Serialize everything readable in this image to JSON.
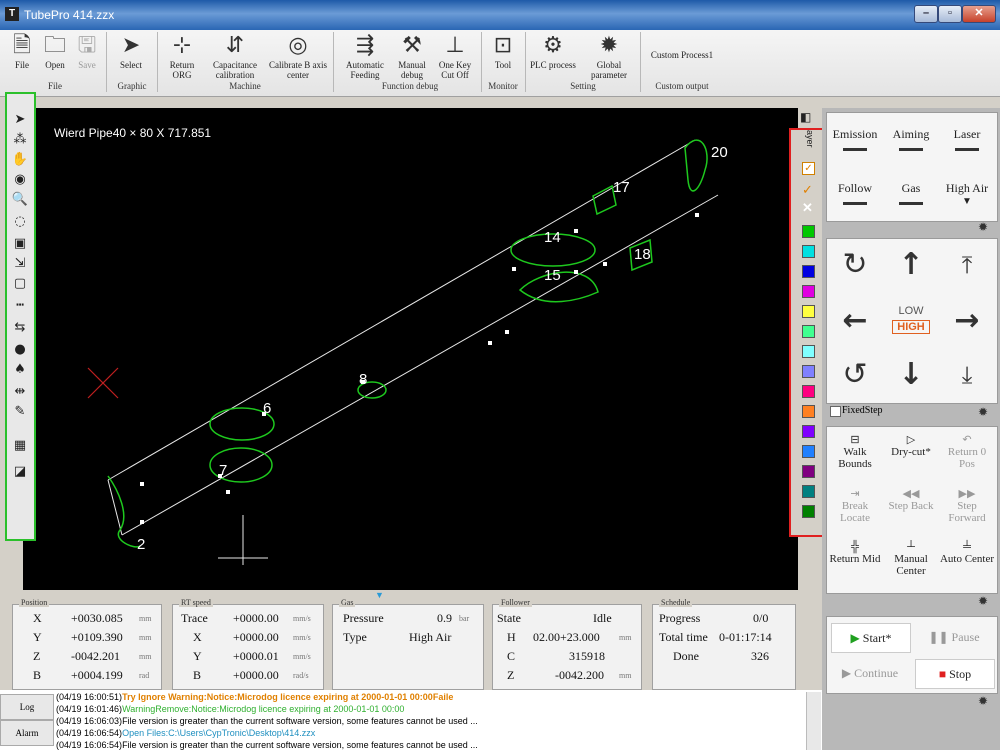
{
  "window": {
    "title": "TubePro 414.zzx",
    "logo": "T"
  },
  "ribbon": {
    "buttons": [
      {
        "label": "File",
        "icon": "file-icon"
      },
      {
        "label": "Open",
        "icon": "folder-icon"
      },
      {
        "label": "Save",
        "icon": "save-icon"
      },
      {
        "label": "Select",
        "icon": "cursor-icon"
      },
      {
        "label": "Return ORG",
        "icon": "axes-icon"
      },
      {
        "label": "Capacitance calibration",
        "icon": "calibrate-icon"
      },
      {
        "label": "Calibrate B axis center",
        "icon": "target-icon"
      },
      {
        "label": "Automatic Feeding",
        "icon": "feed-icon"
      },
      {
        "label": "Manual debug",
        "icon": "wrench-icon"
      },
      {
        "label": "One Key Cut Off",
        "icon": "cutoff-icon"
      },
      {
        "label": "Tool",
        "icon": "monitor-icon"
      },
      {
        "label": "PLC process",
        "icon": "plc-icon"
      },
      {
        "label": "Global parameter",
        "icon": "gear-icon"
      },
      {
        "label": "Custom Process1",
        "icon": ""
      }
    ],
    "groups": [
      "File",
      "Graphic",
      "Machine",
      "Function debug",
      "Monitor",
      "Setting",
      "Custom output"
    ]
  },
  "canvas": {
    "info": "Wierd Pipe40 × 80 X 717.851",
    "labels": [
      "20",
      "17",
      "14",
      "15",
      "18",
      "8",
      "6",
      "7",
      "2"
    ]
  },
  "layers": {
    "label": "ayer",
    "colors": [
      "#00c800",
      "#00e0e0",
      "#0000e0",
      "#e000e0",
      "#ffff40",
      "#40ff90",
      "#80ffff",
      "#8080ff",
      "#ff0080",
      "#ff8020",
      "#8000ff",
      "#2080ff",
      "#800080",
      "#008080",
      "#008000"
    ]
  },
  "laser_panel": {
    "items": [
      "Emission",
      "Aiming",
      "Laser",
      "Follow",
      "Gas",
      "High Air"
    ]
  },
  "jog": {
    "speed_low": "LOW",
    "speed_high": "HIGH",
    "fixed_step": "FixedStep"
  },
  "motion_panel": {
    "items": [
      "Walk Bounds",
      "Dry-cut*",
      "Return 0 Pos",
      "Break Locate",
      "Step Back",
      "Step Forward",
      "Return Mid",
      "Manual Center",
      "Auto Center"
    ]
  },
  "run_panel": {
    "start": "Start*",
    "pause": "Pause",
    "continue": "Continue",
    "stop": "Stop"
  },
  "status": {
    "position": {
      "title": "Position",
      "rows": [
        {
          "axis": "X",
          "value": "+0030.085",
          "unit": "mm"
        },
        {
          "axis": "Y",
          "value": "+0109.390",
          "unit": "mm"
        },
        {
          "axis": "Z",
          "value": "-0042.201",
          "unit": "mm"
        },
        {
          "axis": "B",
          "value": "+0004.199",
          "unit": "rad"
        }
      ]
    },
    "rt_speed": {
      "title": "RT speed",
      "rows": [
        {
          "axis": "Trace",
          "value": "+0000.00",
          "unit": "mm/s"
        },
        {
          "axis": "X",
          "value": "+0000.00",
          "unit": "mm/s"
        },
        {
          "axis": "Y",
          "value": "+0000.01",
          "unit": "mm/s"
        },
        {
          "axis": "B",
          "value": "+0000.00",
          "unit": "rad/s"
        }
      ]
    },
    "gas": {
      "title": "Gas",
      "pressure_label": "Pressure",
      "pressure_value": "0.9",
      "pressure_unit": "bar",
      "type_label": "Type",
      "type_value": "High Air"
    },
    "follower": {
      "title": "Follower",
      "rows": [
        {
          "label": "State",
          "value": "Idle",
          "unit": ""
        },
        {
          "label": "H",
          "value": "02.00+23.000",
          "unit": "mm"
        },
        {
          "label": "C",
          "value": "315918",
          "unit": ""
        },
        {
          "label": "Z",
          "value": "-0042.200",
          "unit": "mm"
        }
      ]
    },
    "schedule": {
      "title": "Schedule",
      "rows": [
        {
          "label": "Progress",
          "value": "0/0"
        },
        {
          "label": "Total time",
          "value": "0-01:17:14"
        },
        {
          "label": "Done",
          "value": "326"
        }
      ]
    }
  },
  "log": {
    "tabs": [
      "Log",
      "Alarm"
    ],
    "lines": [
      {
        "time": "(04/19 16:00:51)",
        "text": "Try Ignore Warning:Notice:Microdog licence expiring at 2000-01-01 00:00Faile",
        "color": "#e08000"
      },
      {
        "time": "(04/19 16:01:46)",
        "text": "WarningRemove:Notice:Microdog licence expiring at 2000-01-01 00:00",
        "color": "#30b030"
      },
      {
        "time": "(04/19 16:06:03)",
        "text": "File version is greater than the current software version, some features cannot be used ...",
        "color": "#111111"
      },
      {
        "time": "(04/19 16:06:54)",
        "text": "Open Files:C:\\Users\\CypTronic\\Desktop\\414.zzx",
        "color": "#2090c0"
      },
      {
        "time": "(04/19 16:06:54)",
        "text": "File version is greater than the current software version, some features cannot be used ...",
        "color": "#111111"
      }
    ]
  }
}
